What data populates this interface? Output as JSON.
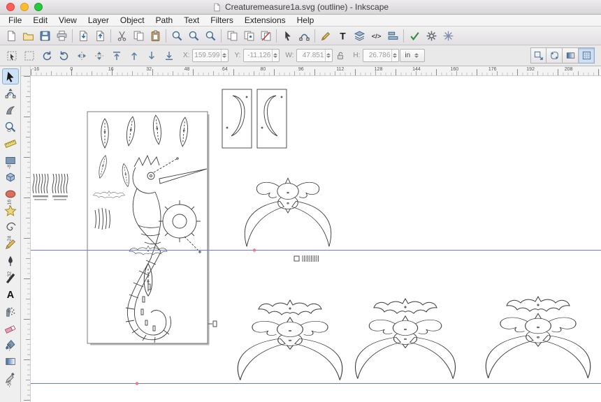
{
  "window": {
    "title": "Creaturemeasure1a.svg (outline) - Inkscape",
    "controls": [
      "close",
      "minimize",
      "zoom"
    ],
    "traffic_colors": {
      "close": "#ff5f57",
      "minimize": "#febc2e",
      "zoom": "#28c840"
    }
  },
  "menubar": {
    "items": [
      "File",
      "Edit",
      "View",
      "Layer",
      "Object",
      "Path",
      "Text",
      "Filters",
      "Extensions",
      "Help"
    ]
  },
  "commandbar": {
    "buttons": [
      "new-document",
      "open-document",
      "save-document",
      "print-document",
      "import-bitmap",
      "export-bitmap",
      "cut",
      "copy",
      "paste",
      "zoom-selection",
      "zoom-drawing",
      "zoom-page",
      "duplicate",
      "create-clone",
      "unlink-clone",
      "edit-objects",
      "edit-paths",
      "fill-stroke-dialog",
      "text-dialog",
      "layers-dialog",
      "xml-editor",
      "align-distribute",
      "spellcheck",
      "preferences",
      "snap-controls"
    ]
  },
  "tool_controls": {
    "buttons": [
      "select-all",
      "deselect",
      "rotate-ccw",
      "rotate-cw",
      "flip-horizontal",
      "flip-vertical",
      "raise-to-top",
      "raise",
      "lower",
      "lower-to-bottom"
    ],
    "x_label": "X:",
    "x_value": "159.599",
    "y_label": "Y:",
    "y_value": "-11.126",
    "w_label": "W:",
    "w_value": "47.851",
    "h_label": "H:",
    "h_value": "26.786",
    "lock": "lock-open",
    "units": "in",
    "toggles": [
      "transform-stroke",
      "transform-corners",
      "transform-gradients",
      "transform-patterns"
    ]
  },
  "rulers": {
    "h": [
      "-16",
      "0",
      "16",
      "32",
      "48",
      "64",
      "80",
      "96",
      "112",
      "128",
      "144",
      "160",
      "176",
      "192",
      "208"
    ],
    "v": [
      "8",
      "0",
      "-8",
      "-16",
      "-24",
      "-32",
      "-40",
      "-48",
      "-56"
    ]
  },
  "toolbox": {
    "active_tool": "selector",
    "tools": [
      "selector",
      "node-editor",
      "tweak",
      "zoom",
      "measure",
      "rectangle",
      "box-3d",
      "ellipse",
      "star",
      "spiral",
      "pencil",
      "bezier-pen",
      "calligraphy",
      "text",
      "spray",
      "eraser",
      "paint-bucket",
      "gradient",
      "dropper"
    ]
  },
  "canvas": {
    "guide_color": "#6b78e8",
    "guide_count": 2
  }
}
